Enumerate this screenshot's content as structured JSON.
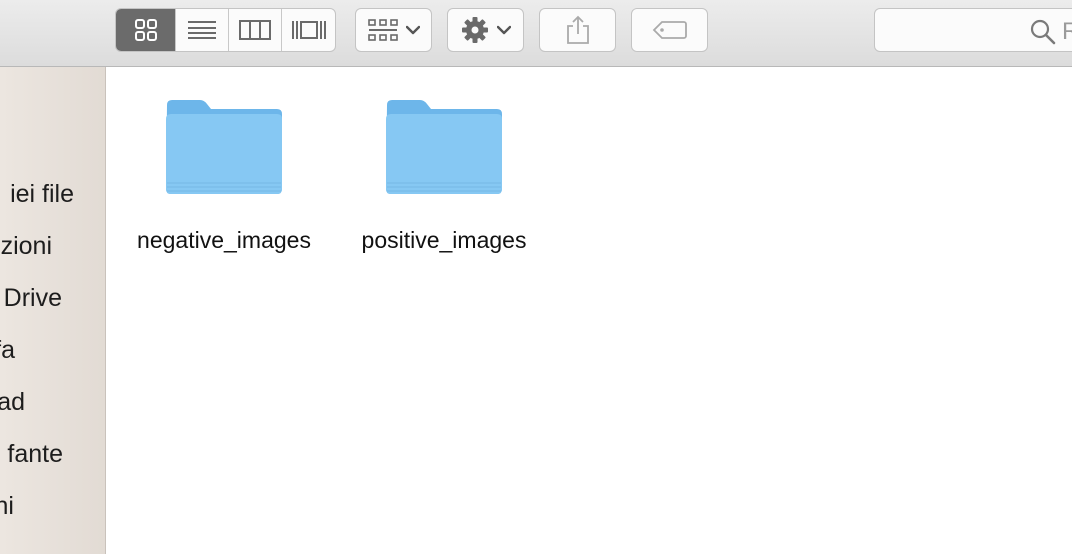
{
  "toolbar": {
    "view_modes": [
      "icon-view",
      "list-view",
      "column-view",
      "cover-flow-view"
    ],
    "active_view": "icon-view",
    "arrange_icon": "grid-arrange-icon",
    "action_icon": "gear-icon",
    "share_icon": "share-icon",
    "tag_icon": "tag-icon"
  },
  "search": {
    "placeholder": "R"
  },
  "sidebar": {
    "items": [
      {
        "label": "iei file"
      },
      {
        "label": "zioni"
      },
      {
        "label": " Drive"
      },
      {
        "label": "fa"
      },
      {
        "label": "ad"
      },
      {
        "label": "fante"
      },
      {
        "label": "ni"
      }
    ]
  },
  "files": [
    {
      "name": "negative_images",
      "icon": "folder-icon"
    },
    {
      "name": "positive_images",
      "icon": "folder-icon"
    }
  ],
  "colors": {
    "folder_body": "#86c8f3",
    "folder_tab": "#6db6ea",
    "active_segment": "#6b6b6b",
    "sidebar_bg": "#e6dfd8"
  }
}
